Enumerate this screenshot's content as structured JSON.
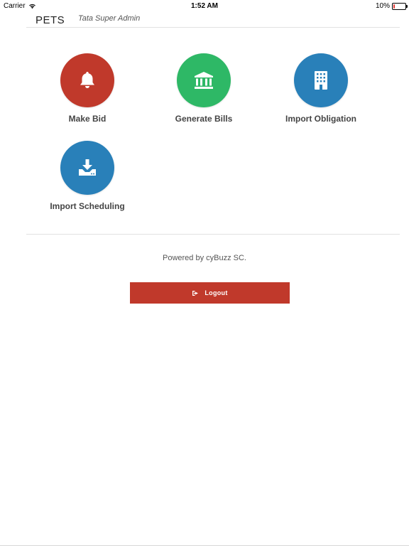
{
  "status_bar": {
    "carrier": "Carrier",
    "time": "1:52 AM",
    "battery": "10%",
    "battery_level": 0.1
  },
  "header": {
    "title": "PETS",
    "user": "Tata Super Admin"
  },
  "tiles": [
    {
      "label": "Make Bid",
      "icon": "bell-icon",
      "color": "#c0392b"
    },
    {
      "label": "Generate Bills",
      "icon": "bank-icon",
      "color": "#2eb866"
    },
    {
      "label": "Import Obligation",
      "icon": "building-icon",
      "color": "#2980b9"
    },
    {
      "label": "Import Scheduling",
      "icon": "download-tray-icon",
      "color": "#2980b9"
    }
  ],
  "footer": {
    "powered_by": "Powered by cyBuzz SC.",
    "logout_label": "Logout"
  }
}
